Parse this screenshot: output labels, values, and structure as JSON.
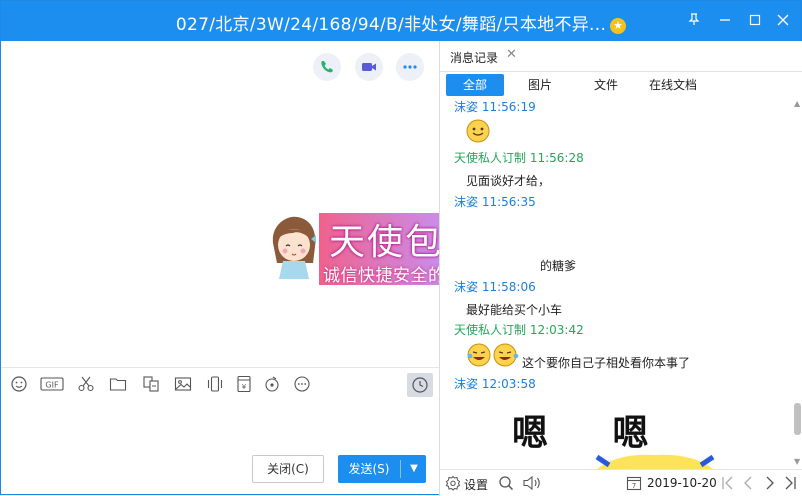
{
  "window": {
    "title": "027/北京/3W/24/168/94/B/非处女/舞蹈/只本地不异...",
    "accent": "#1c8ef0"
  },
  "compose": {
    "banner_title": "天使包养网",
    "banner_subtitle": "诚信快捷安全的交友平台",
    "close_label": "关闭(C)",
    "send_label": "发送(S)"
  },
  "history": {
    "tab_label": "消息记录",
    "filters": [
      "全部",
      "图片",
      "文件",
      "在线文档"
    ],
    "messages": [
      {
        "sender": "沫姿",
        "time": "11:56:19",
        "content": ""
      },
      {
        "sender": "天使私人订制",
        "time": "11:56:28",
        "content": "见面谈好才给，"
      },
      {
        "sender": "沫姿",
        "time": "11:56:35",
        "content": "的糖爹"
      },
      {
        "sender": "沫姿",
        "time": "11:58:06",
        "content": "最好能给买个小车"
      },
      {
        "sender": "天使私人订制",
        "time": "12:03:42",
        "content": "这个要你自己子相处看你本事了"
      },
      {
        "sender": "沫姿",
        "time": "12:03:58",
        "content": ""
      }
    ],
    "sticker_text": "嗯 嗯",
    "settings_label": "设置",
    "date": "2019-10-20"
  }
}
